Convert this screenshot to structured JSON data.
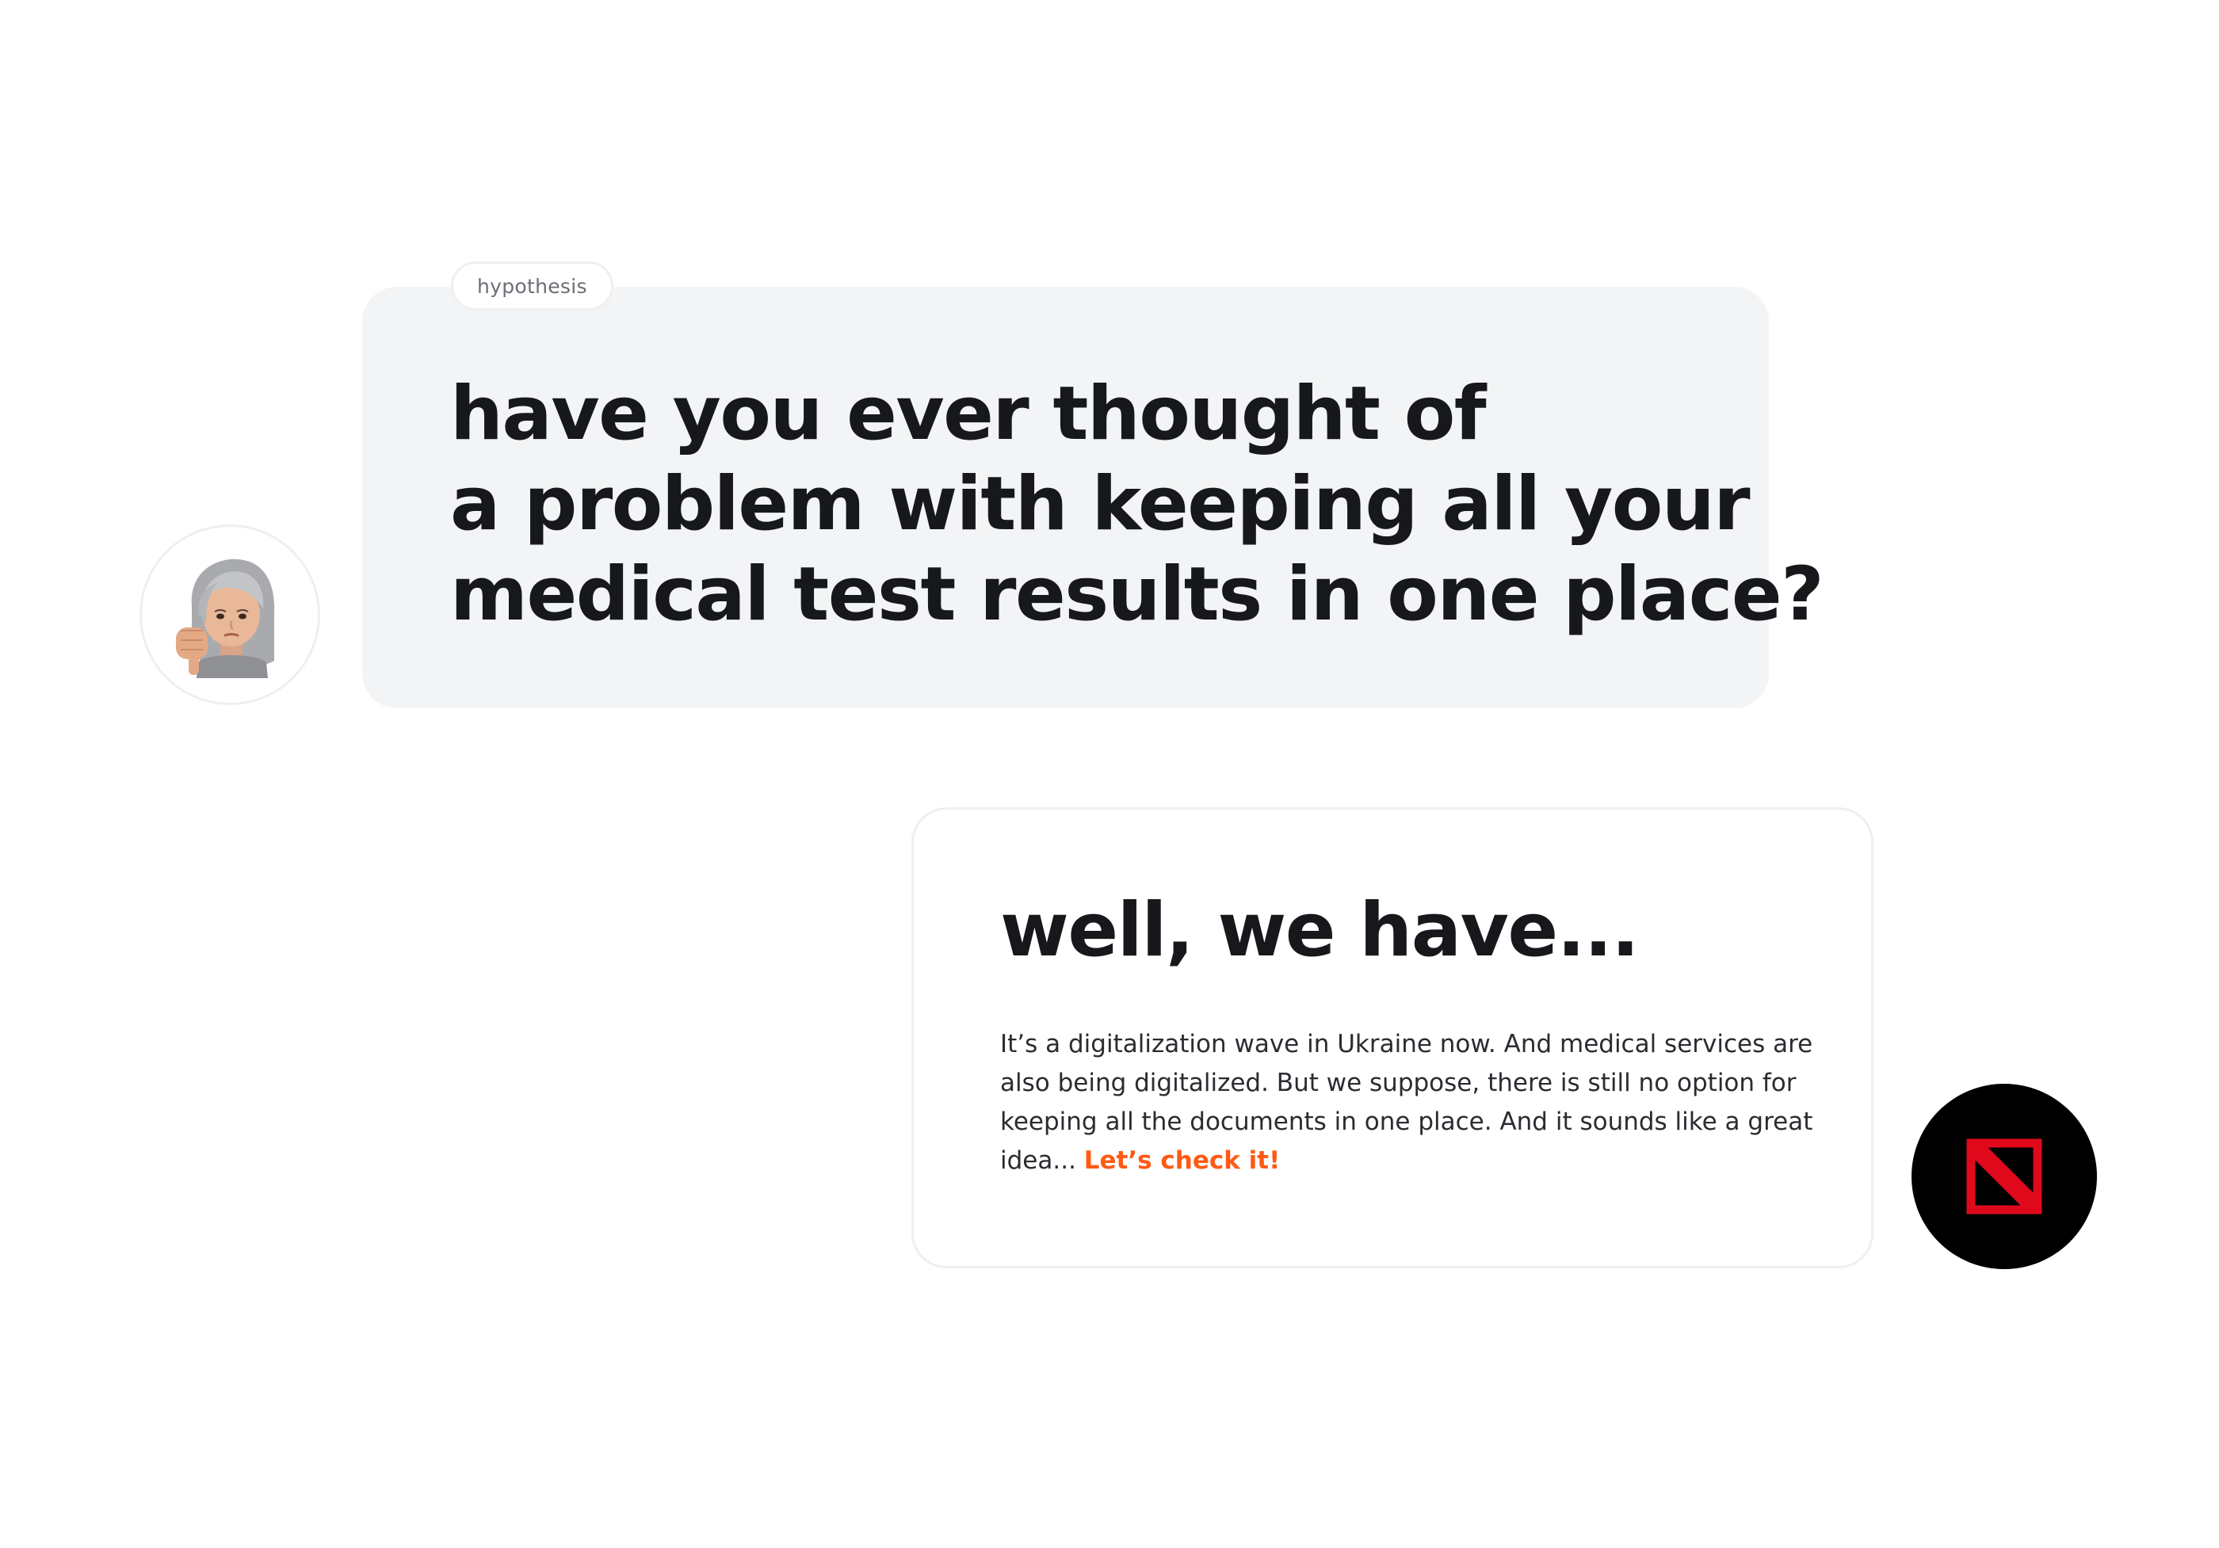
{
  "question": {
    "tag": "hypothesis",
    "lines": [
      "have you ever thought of",
      "a problem with keeping all your",
      "medical test results in one place?"
    ]
  },
  "answer": {
    "title": "well, we have...",
    "body_lines": [
      "It’s a digitalization wave in Ukraine now. And medical services are",
      "also being digitalized. But we suppose, there is still no option for",
      "keeping all the documents in one place. And it sounds like a great"
    ],
    "body_last_prefix": "idea... ",
    "cta": "Let’s check it!"
  },
  "avatars": {
    "user": "memoji-thumbs-down-icon",
    "brand": "brand-logo-icon"
  },
  "colors": {
    "accent": "#ff5a14",
    "brand_red": "#e0091c",
    "card_bg": "#f3f4f5",
    "text": "#17181c"
  }
}
